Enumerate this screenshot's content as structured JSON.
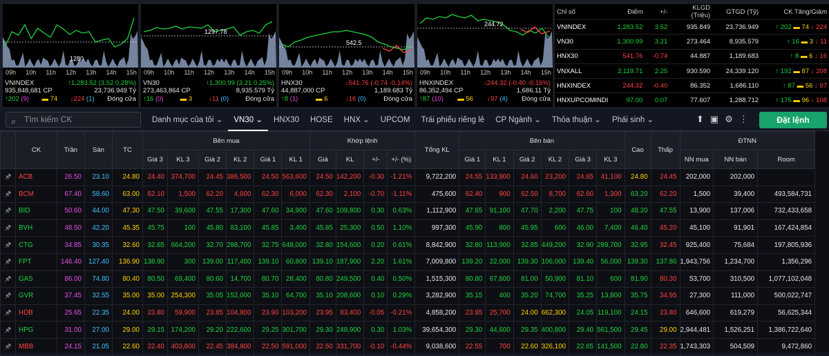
{
  "colors": {
    "up": "#1fd33e",
    "down": "#ff4242",
    "ref": "#ffd200",
    "ceiling": "#e64ee6",
    "floor": "#3fc0ff",
    "accent": "#17a36b"
  },
  "panels": [
    {
      "name": "VNINDEX",
      "ref_label": "1280",
      "hours": [
        "09h",
        "10h",
        "11h",
        "12h",
        "13h",
        "14h",
        "15h"
      ],
      "change": "↑1,283.52 (3.52 0.28%)",
      "volume": "935,848,681 CP",
      "value": "23,736.949 Tỷ",
      "adv": "↑202",
      "adv_n": "(9)",
      "unch": "74",
      "dec": "↓224",
      "dec_n": "(1)",
      "status": "Đóng cửa"
    },
    {
      "name": "VN30",
      "ref_label": "1297.78",
      "hours": [
        "09h",
        "10h",
        "11h",
        "12h",
        "13h",
        "14h",
        "15h"
      ],
      "change": "↑1,300.99 (3.21 0.25%)",
      "volume": "273,463,864 CP",
      "value": "8,935.579 Tỷ",
      "adv": "↑16",
      "adv_n": "(0)",
      "unch": "3",
      "dec": "↓11",
      "dec_n": "(0)",
      "status": "Đóng cửa"
    },
    {
      "name": "HNX30",
      "ref_label": "542.5",
      "hours": [
        "09h",
        "10h",
        "11h",
        "12h",
        "13h",
        "14h",
        "15h"
      ],
      "change": "↓541.76 (-0.74 -0.14%)",
      "volume": "44,887,000 CP",
      "value": "1,189.683 Tỷ",
      "adv": "↑8",
      "adv_n": "(1)",
      "unch": "6",
      "dec": "↓16",
      "dec_n": "(0)",
      "status": "Đóng cửa"
    },
    {
      "name": "HNXINDEX",
      "ref_label": "244.72",
      "hours": [
        "09h",
        "10h",
        "11h",
        "12h",
        "13h",
        "14h",
        "15h"
      ],
      "change": "↓244.32 (-0.40 -0.16%)",
      "volume": "86,352,494 CP",
      "value": "1,686.11 Tỷ",
      "adv": "↑87",
      "adv_n": "(10)",
      "unch": "56",
      "dec": "↓97",
      "dec_n": "(4)",
      "status": "Đóng cửa"
    }
  ],
  "index_table": {
    "headers": [
      "Chỉ số",
      "Điểm",
      "+/-",
      "KLGD (Triệu)",
      "GTGD (Tỷ)",
      "CK Tăng/Giảm"
    ],
    "rows": [
      {
        "name": "VNINDEX",
        "point": "1,283.52",
        "chg": "3.52",
        "vol": "935.849",
        "val": "23,736.949",
        "adv": "↑ 202",
        "unch": "74",
        "dec": "↓ 224",
        "dir": "up"
      },
      {
        "name": "VN30",
        "point": "1,300.99",
        "chg": "3.21",
        "vol": "273.464",
        "val": "8,935.579",
        "adv": "↑ 16",
        "unch": "3",
        "dec": "↓ 11",
        "dir": "up"
      },
      {
        "name": "HNX30",
        "point": "541.76",
        "chg": "-0.74",
        "vol": "44.887",
        "val": "1,189.683",
        "adv": "↑ 8",
        "unch": "6",
        "dec": "↓ 16",
        "dir": "down"
      },
      {
        "name": "VNXALL",
        "point": "2,119.71",
        "chg": "2.25",
        "vol": "930.590",
        "val": "24,339.120",
        "adv": "↑ 192",
        "unch": "87",
        "dec": "↓ 208",
        "dir": "up"
      },
      {
        "name": "HNXINDEX",
        "point": "244.32",
        "chg": "-0.40",
        "vol": "86.352",
        "val": "1,686.110",
        "adv": "↑ 87",
        "unch": "56",
        "dec": "↓ 97",
        "dir": "down"
      },
      {
        "name": "HNXUPCOMINDI",
        "point": "97.00",
        "chg": "0.07",
        "vol": "77.607",
        "val": "1,288.712",
        "adv": "↑ 175",
        "unch": "96",
        "dec": "↓ 108",
        "dir": "up"
      }
    ]
  },
  "toolbar": {
    "search_placeholder": "Tìm kiếm CK",
    "tabs": [
      "Danh mục của tôi",
      "VN30",
      "HNX30",
      "HOSE",
      "HNX",
      "UPCOM",
      "Trái phiếu riêng lẻ",
      "CP Ngành",
      "Thỏa thuận",
      "Phái sinh"
    ],
    "order_button": "Đặt lệnh"
  },
  "board": {
    "groups": [
      "Bên mua",
      "Khớp lệnh",
      "Bên bán",
      "ĐTNN"
    ],
    "headers": [
      "CK",
      "Trần",
      "Sàn",
      "TC",
      "Giá 3",
      "KL 3",
      "Giá 2",
      "KL 2",
      "Giá 1",
      "KL 1",
      "Giá",
      "KL",
      "+/-",
      "+/- (%)",
      "Tổng KL",
      "Giá 1",
      "KL 1",
      "Giá 2",
      "KL 2",
      "Giá 3",
      "KL 3",
      "Cao",
      "Thấp",
      "NN mua",
      "NN bán",
      "Room"
    ],
    "rows": [
      [
        "ACB",
        "26.50",
        "23.10",
        "24.80",
        "24.40",
        "374,700",
        "24.45",
        "386,500",
        "24.50",
        "563,600",
        "24.50",
        "142,200",
        "-0.30",
        "-1.21%",
        "9,722,200",
        "24.55",
        "133,900",
        "24.60",
        "23,200",
        "24.65",
        "41,100",
        "24.80",
        "24.45",
        "202,000",
        "202,000",
        ""
      ],
      [
        "BCM",
        "67.40",
        "58.60",
        "63.00",
        "62.10",
        "1,500",
        "62.20",
        "4,600",
        "62.30",
        "6,000",
        "62.30",
        "2,100",
        "-0.70",
        "-1.11%",
        "475,600",
        "62.40",
        "900",
        "62.50",
        "8,700",
        "62.60",
        "1,300",
        "63.20",
        "62.20",
        "1,500",
        "39,400",
        "493,584,731"
      ],
      [
        "BID",
        "50.60",
        "44.00",
        "47.30",
        "47.50",
        "39,600",
        "47.55",
        "17,300",
        "47.60",
        "34,900",
        "47.60",
        "109,800",
        "0.30",
        "0.63%",
        "1,112,900",
        "47.65",
        "91,100",
        "47.70",
        "2,200",
        "47.75",
        "100",
        "48.20",
        "47.55",
        "13,900",
        "137,006",
        "732,433,658"
      ],
      [
        "BVH",
        "48.50",
        "42.20",
        "45.35",
        "45.75",
        "100",
        "45.80",
        "83,100",
        "45.85",
        "3,400",
        "45.85",
        "25,300",
        "0.50",
        "1.10%",
        "997,300",
        "45.90",
        "800",
        "45.95",
        "600",
        "46.00",
        "7,400",
        "46.40",
        "45.20",
        "45,100",
        "91,901",
        "167,424,854"
      ],
      [
        "CTG",
        "34.85",
        "30.35",
        "32.60",
        "32.65",
        "664,200",
        "32.70",
        "288,700",
        "32.75",
        "648,000",
        "32.80",
        "154,600",
        "0.20",
        "0.61%",
        "8,842,900",
        "32.80",
        "113,900",
        "32.85",
        "449,200",
        "32.90",
        "289,700",
        "32.95",
        "32.45",
        "925,400",
        "75,684",
        "197,805,936"
      ],
      [
        "FPT",
        "146.40",
        "127.40",
        "136.90",
        "138.90",
        "300",
        "139.00",
        "117,400",
        "139.10",
        "60,800",
        "139.10",
        "187,900",
        "2.20",
        "1.61%",
        "7,009,800",
        "139.20",
        "22,000",
        "139.30",
        "106,000",
        "139.40",
        "56,000",
        "139.30",
        "137.80",
        "1,943,756",
        "1,234,700",
        "1,356,296"
      ],
      [
        "GAS",
        "86.00",
        "74.80",
        "80.40",
        "80.50",
        "69,400",
        "80.60",
        "14,700",
        "80.70",
        "28,400",
        "80.80",
        "249,500",
        "0.40",
        "0.50%",
        "1,515,300",
        "80.80",
        "67,800",
        "81.00",
        "50,900",
        "81.10",
        "600",
        "81.90",
        "80.30",
        "53,700",
        "310,500",
        "1,077,102,048"
      ],
      [
        "GVR",
        "37.45",
        "32.55",
        "35.00",
        "35.00",
        "254,300",
        "35.05",
        "152,000",
        "35.10",
        "64,700",
        "35.10",
        "208,600",
        "0.10",
        "0.29%",
        "3,282,900",
        "35.15",
        "400",
        "35.20",
        "74,700",
        "35.25",
        "13,800",
        "35.75",
        "34.95",
        "27,300",
        "111,000",
        "500,022,747"
      ],
      [
        "HDB",
        "25.65",
        "22.35",
        "24.00",
        "23.80",
        "59,900",
        "23.85",
        "104,800",
        "23.90",
        "103,200",
        "23.95",
        "83,400",
        "-0.05",
        "-0.21%",
        "4,858,200",
        "23.95",
        "25,700",
        "24.00",
        "662,300",
        "24.05",
        "119,100",
        "24.15",
        "23.80",
        "646,600",
        "619,279",
        "56,625,344"
      ],
      [
        "HPG",
        "31.00",
        "27.00",
        "29.00",
        "29.15",
        "174,200",
        "29.20",
        "222,600",
        "29.25",
        "301,700",
        "29.30",
        "248,900",
        "0.30",
        "1.03%",
        "39,654,300",
        "29.30",
        "44,600",
        "29.35",
        "400,800",
        "29.40",
        "561,500",
        "29.45",
        "29.00",
        "2,944,481",
        "1,526,251",
        "1,386,722,640"
      ],
      [
        "MBB",
        "24.15",
        "21.05",
        "22.60",
        "22.40",
        "403,800",
        "22.45",
        "384,800",
        "22.50",
        "591,000",
        "22.50",
        "331,700",
        "-0.10",
        "-0.44%",
        "9,038,600",
        "22.55",
        "700",
        "22.60",
        "326,100",
        "22.65",
        "141,500",
        "22.80",
        "22.35",
        "1,743,303",
        "504,509",
        "9,472,860"
      ]
    ]
  }
}
